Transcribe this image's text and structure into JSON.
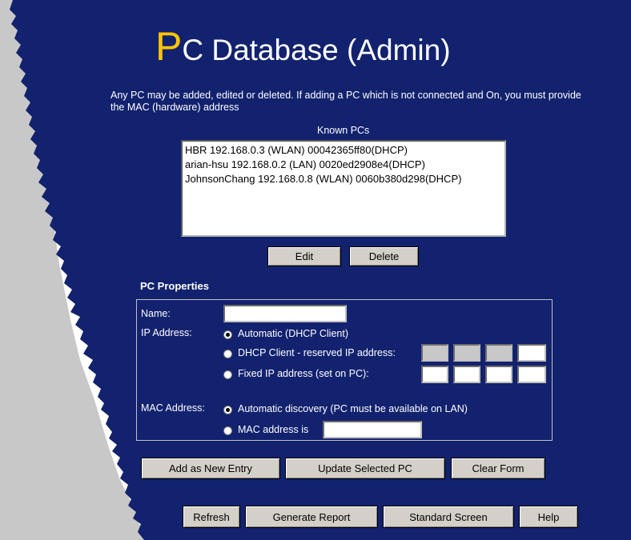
{
  "page": {
    "title_initial": "P",
    "title_rest": "C Database (Admin)",
    "intro": "Any PC may be added, edited or deleted. If adding a PC which is not connected and On, you must provide the MAC (hardware) address",
    "colors": {
      "background": "#12226e",
      "title_accent": "#ffc400",
      "left_strip": "#c8c8c8"
    }
  },
  "known_pcs": {
    "label": "Known PCs",
    "items": [
      "HBR 192.168.0.3 (WLAN) 00042365ff80(DHCP)",
      "arian-hsu 192.168.0.2 (LAN) 0020ed2908e4(DHCP)",
      "JohnsonChang 192.168.0.8 (WLAN) 0060b380d298(DHCP)"
    ],
    "edit_label": "Edit",
    "delete_label": "Delete"
  },
  "properties": {
    "section_title": "PC Properties",
    "name_label": "Name:",
    "name_value": "",
    "ip_label": "IP Address:",
    "ip_options": [
      {
        "label": "Automatic (DHCP Client)",
        "selected": true
      },
      {
        "label": "DHCP Client - reserved IP address:",
        "selected": false
      },
      {
        "label": "Fixed IP address (set on PC):",
        "selected": false
      }
    ],
    "mac_label": "MAC Address:",
    "mac_options": [
      {
        "label": "Automatic discovery (PC must be available on LAN)",
        "selected": true
      },
      {
        "label": "MAC address is",
        "selected": false
      }
    ],
    "mac_value": ""
  },
  "actions": {
    "add_label": "Add as New Entry",
    "update_label": "Update Selected PC",
    "clear_label": "Clear Form"
  },
  "footer": {
    "refresh_label": "Refresh",
    "report_label": "Generate Report",
    "standard_label": "Standard Screen",
    "help_label": "Help"
  }
}
